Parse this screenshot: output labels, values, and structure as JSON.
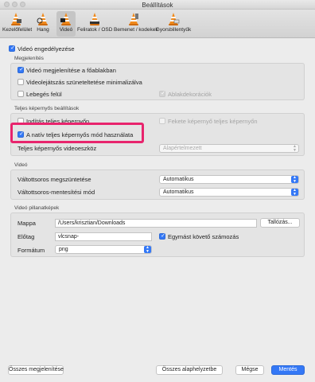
{
  "window": {
    "title": "Beállítások"
  },
  "toolbar": {
    "items": [
      {
        "label": "Kezelőfelület",
        "icon": "interface-cone-icon"
      },
      {
        "label": "Hang",
        "icon": "audio-cone-icon"
      },
      {
        "label": "Videó",
        "icon": "video-cone-icon",
        "selected": true
      },
      {
        "label": "Feliratok / OSD",
        "icon": "subtitles-cone-icon"
      },
      {
        "label": "Bemenet / kodekek",
        "icon": "input-cone-icon"
      },
      {
        "label": "Gyorsbillentyűk",
        "icon": "hotkeys-cone-icon"
      }
    ]
  },
  "video_enable": {
    "label": "Videó engedélyezése",
    "checked": true
  },
  "display": {
    "heading": "Megjelenítés",
    "show_main": {
      "label": "Videó megjelenítése a főablakban",
      "checked": true
    },
    "minimize_on_pause": {
      "label": "Videolejátszás szüneteltetése minimalizálva",
      "checked": false
    },
    "float_on_top": {
      "label": "Lebegés felül",
      "checked": false
    },
    "window_decorations": {
      "label": "Ablakdekorációk",
      "checked": true,
      "disabled": true
    }
  },
  "fullscreen": {
    "heading": "Teljes képernyős beállítások",
    "start_fullscreen": {
      "label": "Indítás teljes képernyőn",
      "checked": false
    },
    "black_screens": {
      "label": "Fekete képernyő teljes képernyőn",
      "checked": false,
      "disabled": true
    },
    "native_fullscreen": {
      "label": "A natív teljes képernyős mód használata",
      "checked": true
    },
    "device_label": "Teljes képernyős videoeszköz",
    "device_value": "Alapértelmezett"
  },
  "video": {
    "heading": "Videó",
    "deinterlace_label": "Váltottsoros megszüntetése",
    "deinterlace_value": "Automatikus",
    "deinterlace_mode_label": "Váltottsoros-mentesítési mód",
    "deinterlace_mode_value": "Automatikus"
  },
  "snapshots": {
    "heading": "Videó pillanatképek",
    "folder_label": "Mappa",
    "folder_value": "/Users/krisztian/Downloads",
    "browse_label": "Tallózás...",
    "prefix_label": "Előtag",
    "prefix_value": "vlcsnap-",
    "sequential_label": "Egymást követő számozás",
    "sequential_checked": true,
    "format_label": "Formátum",
    "format_value": "png"
  },
  "footer": {
    "show_all": "Összes megjelenítése",
    "reset_all": "Összes alaphelyzetbe",
    "cancel": "Mégse",
    "save": "Mentés"
  },
  "colors": {
    "accent": "#3478f6",
    "highlight": "#e8246d",
    "cone": "#f08a1c"
  }
}
